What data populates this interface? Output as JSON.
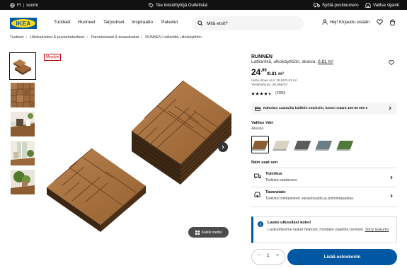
{
  "topbar": {
    "language_short": "FI",
    "language": "suomi",
    "promo": "Tee loistolöytöjä Outletista!",
    "postal": "Syötä postinumero",
    "store": "Valitse sijainti"
  },
  "header": {
    "logo": "IKEA",
    "nav": [
      "Tuotteet",
      "Huoneet",
      "Tarjoukset",
      "Inspiraatio",
      "Palvelut"
    ],
    "search_placeholder": "Mitä etsit?",
    "login": "Hej! Kirjaudu sisään"
  },
  "breadcrumb": [
    "Tuotteet",
    "Ulkokalusteet & puutarhatuotteet",
    "Parvekelaatat & terassilaatat",
    "RUNNEN Lattiaritilä, ulkokäyttöön"
  ],
  "gallery": {
    "badge": "Myydyin",
    "media_button": "Kaikki media"
  },
  "product": {
    "name": "RUNNEN",
    "description": "Lattiaritilä, ulkokäyttöön, akasia,",
    "size": "0.81 m²",
    "price_int": "24",
    "price_dec": ",99",
    "price_unit": "/0.81 m²",
    "vat_note": "Hinta ilman ALV 19,91/0.81 m²",
    "unit_price": "Yksikköhinta: 30,85€/m²",
    "rating_value": 4.5,
    "rating_count": "(2980)",
    "financing": "Rahoitus saatavilla kaikkiin ostoksiin, luoton määrä 100-25 000 €",
    "color_label": "Valitse Väri",
    "color_value": "Akasia",
    "swatch_colors": [
      "#8b5e34",
      "#d9d2c3",
      "#5c5c5c",
      "#6c7d86",
      "#4f7a3a"
    ]
  },
  "options": {
    "section_title": "Näin saat sen",
    "delivery_title": "Toimitus",
    "delivery_sub": "Tarkista saatavuus",
    "store_title": "Tavaratalo",
    "store_sub": "Tarkista toimipisteen varastosaldo ja poimintapaikka"
  },
  "info": {
    "title": "Laske ulkosilasi koko!",
    "body": "Laskurillamme lasket helposti, montako pakettia tarvitset.",
    "link": "Siirry laskuriin"
  },
  "cart": {
    "quantity": "1",
    "minus": "−",
    "plus": "+",
    "add_label": "Lisää ostoskoriin"
  },
  "colors": {
    "brand_blue": "#0058a3",
    "brand_yellow": "#ffda1a",
    "badge_red": "#cc0008"
  }
}
